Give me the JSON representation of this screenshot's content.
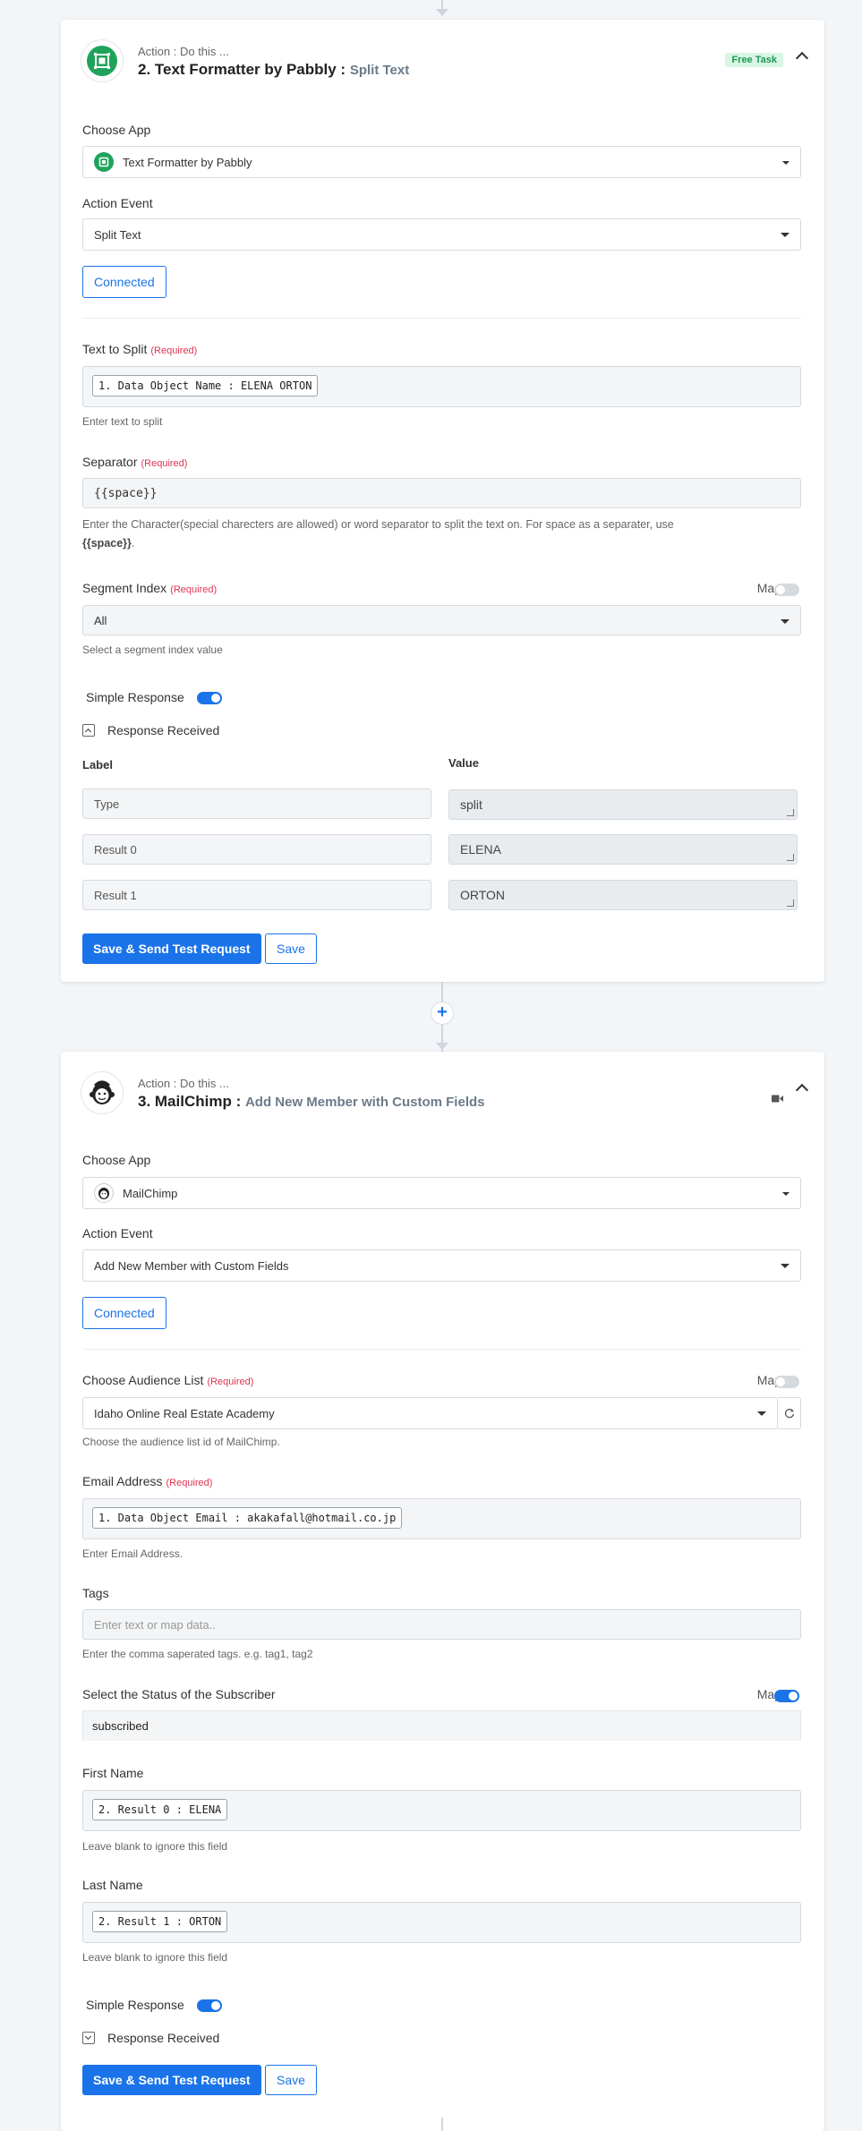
{
  "step2": {
    "head_sub": "Action : Do this ...",
    "title_app": "2. Text Formatter by Pabbly :",
    "title_event": "Split Text",
    "badge": "Free Task",
    "choose_app_label": "Choose App",
    "choose_app_value": "Text Formatter by Pabbly",
    "action_event_label": "Action Event",
    "action_event_value": "Split Text",
    "connected_label": "Connected",
    "text_to_split_label": "Text to Split",
    "required": "(Required)",
    "text_to_split_chip": "1. Data Object Name : ELENA ORTON",
    "text_to_split_help": "Enter text to split",
    "separator_label": "Separator",
    "separator_value": "{{space}}",
    "separator_help_1": "Enter the Character(special charecters are allowed) or word separator to split the text on. For space as a separater, use",
    "separator_help_bold": "{{space}}",
    "separator_help_end": ".",
    "segment_label": "Segment Index",
    "map_label": "Map",
    "segment_value": "All",
    "segment_help": "Select a segment index value",
    "simple_response_label": "Simple Response",
    "response_received_label": "Response Received",
    "col_label": "Label",
    "col_value": "Value",
    "rows": [
      {
        "label": "Type",
        "value": "split"
      },
      {
        "label": "Result 0",
        "value": "ELENA"
      },
      {
        "label": "Result 1",
        "value": "ORTON"
      }
    ],
    "save_send_label": "Save & Send Test Request",
    "save_label": "Save"
  },
  "step3": {
    "head_sub": "Action : Do this ...",
    "title_app": "3. MailChimp :",
    "title_event": "Add New Member with Custom Fields",
    "choose_app_label": "Choose App",
    "choose_app_value": "MailChimp",
    "action_event_label": "Action Event",
    "action_event_value": "Add New Member with Custom Fields",
    "connected_label": "Connected",
    "audience_label": "Choose Audience List",
    "required": "(Required)",
    "map_label": "Map",
    "audience_value": "Idaho Online Real Estate Academy",
    "audience_help": "Choose the audience list id of MailChimp.",
    "email_label": "Email Address",
    "email_chip": "1. Data Object Email : akakafall@hotmail.co.jp",
    "email_help": "Enter Email Address.",
    "tags_label": "Tags",
    "tags_placeholder": "Enter text or map data..",
    "tags_help": "Enter the comma saperated tags. e.g. tag1, tag2",
    "status_label": "Select the Status of the Subscriber",
    "status_value": "subscribed",
    "first_name_label": "First Name",
    "first_name_chip": "2. Result 0 : ELENA",
    "first_name_help": "Leave blank to ignore this field",
    "last_name_label": "Last Name",
    "last_name_chip": "2. Result 1 : ORTON",
    "last_name_help": "Leave blank to ignore this field",
    "simple_response_label": "Simple Response",
    "response_received_label": "Response Received",
    "save_send_label": "Save & Send Test Request",
    "save_label": "Save"
  },
  "colors": {
    "accent": "#1a73e8",
    "pabbly_green": "#1fa35b",
    "required_red": "#e0344f",
    "badge_green": "#d9f5e4"
  },
  "icons": [
    "text-formatter-icon",
    "mailchimp-icon",
    "chevron-up-icon",
    "video-icon",
    "refresh-icon",
    "plus-icon"
  ]
}
